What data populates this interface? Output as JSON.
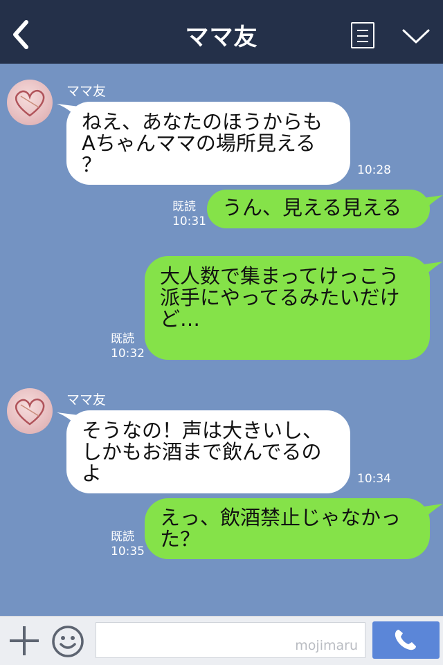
{
  "header": {
    "title": "ママ友"
  },
  "messages": [
    {
      "sender": "ママ友",
      "text": "ねえ、あなたのほうからも\nAちゃんママの場所見える\n？",
      "time": "10:28"
    },
    {
      "text": "うん、見える見える",
      "read": "既読",
      "time": "10:31"
    },
    {
      "text": "大人数で集まってけっこう\n派手にやってるみたいだけ\nど…",
      "read": "既読",
      "time": "10:32"
    },
    {
      "sender": "ママ友",
      "text": "そうなの！声は大きいし、\nしかもお酒まで飲んでるの\nよ",
      "time": "10:34"
    },
    {
      "text": "えっ、飲酒禁止じゃなかっ\nた？",
      "read": "既読",
      "time": "10:35"
    }
  ],
  "footer": {
    "watermark": "mojimaru"
  },
  "icons": {
    "back": "chevron-left-icon",
    "menu": "notes-icon",
    "collapse": "chevron-down-icon",
    "add": "plus-icon",
    "sticker": "smiley-icon",
    "call": "phone-icon"
  },
  "colors": {
    "header": "#243049",
    "background": "#7493c2",
    "incoming_bubble": "#ffffff",
    "outgoing_bubble": "#85e249",
    "send_button": "#5b86d8"
  }
}
